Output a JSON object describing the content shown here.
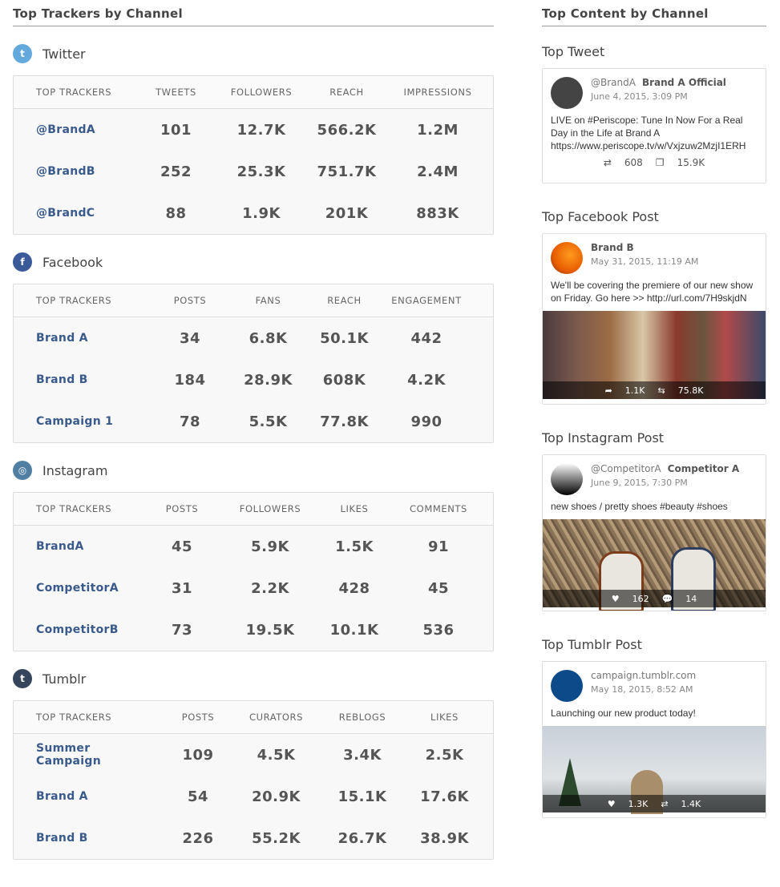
{
  "left_title": "Top Trackers by Channel",
  "right_title": "Top Content by Channel",
  "channels": [
    {
      "name": "Twitter",
      "icon": "twitter-icon",
      "color": "#64a9dc",
      "glyph": "t",
      "headers": [
        "TOP TRACKERS",
        "TWEETS",
        "FOLLOWERS",
        "REACH",
        "IMPRESSIONS"
      ],
      "rows": [
        [
          "@BrandA",
          "101",
          "12.7K",
          "566.2K",
          "1.2M"
        ],
        [
          "@BrandB",
          "252",
          "25.3K",
          "751.7K",
          "2.4M"
        ],
        [
          "@BrandC",
          "88",
          "1.9K",
          "201K",
          "883K"
        ]
      ]
    },
    {
      "name": "Facebook",
      "icon": "facebook-icon",
      "color": "#3b5a99",
      "glyph": "f",
      "headers": [
        "TOP TRACKERS",
        "POSTS",
        "FANS",
        "REACH",
        "ENGAGEMENT"
      ],
      "rows": [
        [
          "Brand A",
          "34",
          "6.8K",
          "50.1K",
          "442"
        ],
        [
          "Brand B",
          "184",
          "28.9K",
          "608K",
          "4.2K"
        ],
        [
          "Campaign 1",
          "78",
          "5.5K",
          "77.8K",
          "990"
        ]
      ]
    },
    {
      "name": "Instagram",
      "icon": "instagram-icon",
      "color": "#517fa4",
      "glyph": "◎",
      "headers": [
        "TOP TRACKERS",
        "POSTS",
        "FOLLOWERS",
        "LIKES",
        "COMMENTS"
      ],
      "rows": [
        [
          "BrandA",
          "45",
          "5.9K",
          "1.5K",
          "91"
        ],
        [
          "CompetitorA",
          "31",
          "2.2K",
          "428",
          "45"
        ],
        [
          "CompetitorB",
          "73",
          "19.5K",
          "10.1K",
          "536"
        ]
      ]
    },
    {
      "name": "Tumblr",
      "icon": "tumblr-icon",
      "color": "#35465c",
      "glyph": "t",
      "headers": [
        "TOP TRACKERS",
        "POSTS",
        "CURATORS",
        "REBLOGS",
        "LIKES"
      ],
      "rows": [
        [
          "Summer Campaign",
          "109",
          "4.5K",
          "3.4K",
          "2.5K"
        ],
        [
          "Brand A",
          "54",
          "20.9K",
          "15.1K",
          "17.6K"
        ],
        [
          "Brand B",
          "226",
          "55.2K",
          "26.7K",
          "38.9K"
        ]
      ]
    }
  ],
  "content": {
    "tweet": {
      "title": "Top Tweet",
      "handle": "@BrandA",
      "name": "Brand A Official",
      "date": "June 4, 2015, 3:09 PM",
      "text": "LIVE on #Periscope: Tune In Now For a Real Day in the Life at Brand A https://www.periscope.tv/w/Vxjzuw2MzjI1ERH",
      "retweets": "608",
      "impressions": "15.9K"
    },
    "facebook": {
      "title": "Top Facebook Post",
      "handle": "",
      "name": "Brand B",
      "date": "May 31, 2015, 11:19 AM",
      "text": "We'll be covering the premiere of our new show on Friday. Go here >> http://url.com/7H9skjdN",
      "shares": "1.1K",
      "reach": "75.8K"
    },
    "instagram": {
      "title": "Top Instagram Post",
      "handle": "@CompetitorA",
      "name": "Competitor A",
      "date": "June 9, 2015, 7:30 PM",
      "text": "new shoes / pretty shoes #beauty #shoes",
      "likes": "162",
      "comments": "14"
    },
    "tumblr": {
      "title": "Top Tumblr Post",
      "handle": "campaign.tumblr.com",
      "name": "",
      "date": "May 18, 2015, 8:52 AM",
      "text": "Launching our new product today!",
      "likes": "1.3K",
      "reblogs": "1.4K"
    }
  }
}
